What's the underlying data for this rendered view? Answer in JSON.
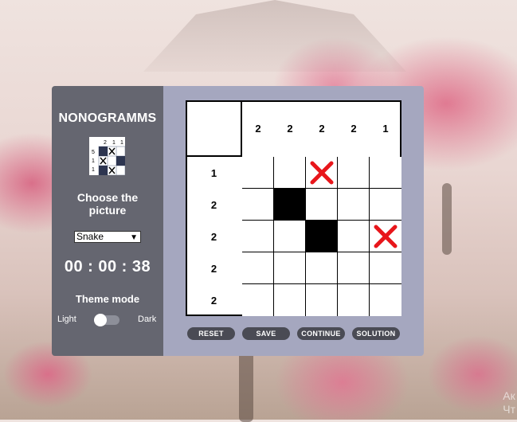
{
  "sidebar": {
    "title": "NONOGRAMMS",
    "choose_label": "Choose the picture",
    "selected_picture": "Snake",
    "timer": "00 : 00 : 38",
    "theme_label": "Theme mode",
    "light_label": "Light",
    "dark_label": "Dark",
    "logo_clues": {
      "top": [
        "2",
        "1",
        "1"
      ],
      "left": [
        "5",
        "1",
        "1"
      ]
    }
  },
  "board": {
    "column_clues": [
      "2",
      "2",
      "2",
      "2",
      "1"
    ],
    "row_clues": [
      "1",
      "2",
      "2",
      "2",
      "2"
    ],
    "cells": [
      [
        "empty",
        "empty",
        "cross",
        "empty",
        "empty"
      ],
      [
        "empty",
        "filled",
        "empty",
        "empty",
        "empty"
      ],
      [
        "empty",
        "empty",
        "filled",
        "empty",
        "cross"
      ],
      [
        "empty",
        "empty",
        "empty",
        "empty",
        "empty"
      ],
      [
        "empty",
        "empty",
        "empty",
        "empty",
        "empty"
      ]
    ]
  },
  "buttons": {
    "reset": "RESET",
    "save": "SAVE",
    "continue": "CONTINUE",
    "solution": "SOLUTION"
  },
  "colors": {
    "cross": "#e8161b",
    "filled": "#000000",
    "sidebar": "#656670",
    "main": "#a5a7bf"
  },
  "watermark": {
    "line1": "Ак",
    "line2": "Чт"
  }
}
